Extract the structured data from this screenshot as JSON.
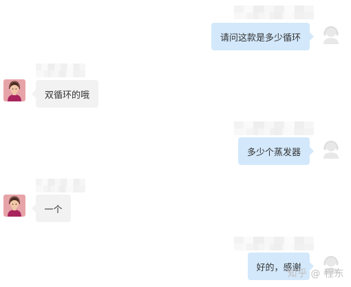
{
  "messages": [
    {
      "direction": "out",
      "text": "请问这款是多少循环"
    },
    {
      "direction": "in",
      "text": "双循环的哦"
    },
    {
      "direction": "out",
      "text": "多少个蒸发器"
    },
    {
      "direction": "in",
      "text": "一个"
    },
    {
      "direction": "out",
      "text": "好的，感谢"
    }
  ],
  "icons": {
    "agent_avatar": "headset-agent-icon",
    "user_avatar": "user-avatar-icon"
  },
  "colors": {
    "outgoing_bubble": "#d3e8fb",
    "incoming_bubble": "#f2f2f2",
    "text": "#333333",
    "watermark": "#c0c0c0"
  },
  "watermark": "知乎 @ 程东"
}
